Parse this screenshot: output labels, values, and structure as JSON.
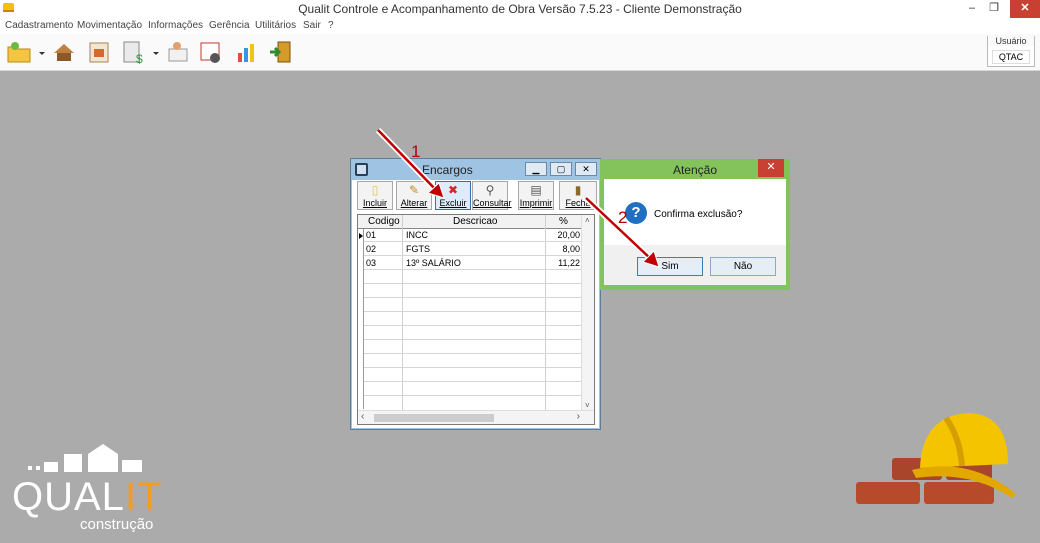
{
  "window": {
    "title": "Qualit Controle e Acompanhamento de Obra Versão 7.5.23 - Cliente Demonstração",
    "min_glyph": "–",
    "restore_glyph": "❐",
    "close_glyph": "✕"
  },
  "menu": [
    "Cadastramento",
    "Movimentação",
    "Informações",
    "Gerência",
    "Utilitários",
    "Sair",
    "?"
  ],
  "user": {
    "label": "Usuário",
    "value": "QTAC"
  },
  "encargos": {
    "title": "Encargos",
    "buttons": {
      "incluir": "Incluir",
      "alterar": "Alterar",
      "excluir": "Excluir",
      "consultar": "Consultar",
      "imprimir": "Imprimir",
      "fechar": "Fecha"
    },
    "columns": {
      "codigo": "Codigo",
      "descricao": "Descricao",
      "pct": "%"
    },
    "rows": [
      {
        "codigo": "01",
        "descricao": "INCC",
        "pct": "20,00"
      },
      {
        "codigo": "02",
        "descricao": "FGTS",
        "pct": "8,00"
      },
      {
        "codigo": "03",
        "descricao": "13º SALÁRIO",
        "pct": "11,22"
      }
    ]
  },
  "dialog": {
    "title": "Atenção",
    "close_glyph": "✕",
    "message": "Confirma exclusão?",
    "yes": "Sim",
    "no": "Não"
  },
  "annotations": {
    "step1": "1",
    "step2": "2"
  },
  "logo": {
    "text_a": "QUAL",
    "text_b": "IT",
    "sub": "construção"
  },
  "colors": {
    "desktop": "#ababab",
    "dialog_frame": "#84c35b",
    "close_red": "#c84031",
    "arrow_red": "#c00000"
  }
}
